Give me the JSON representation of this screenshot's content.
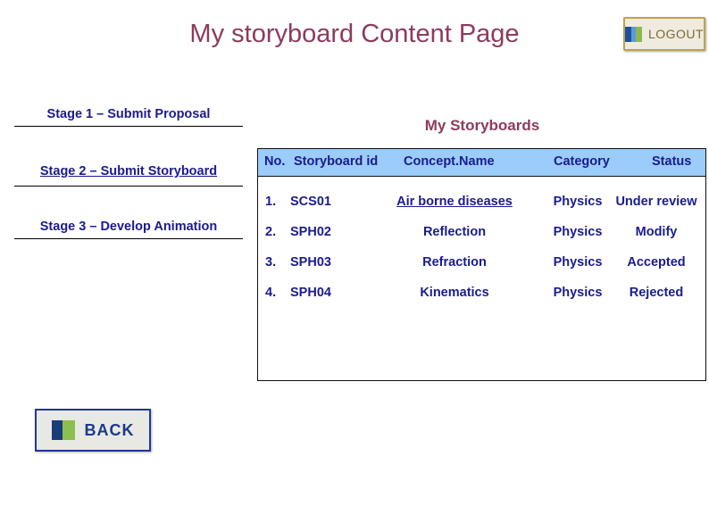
{
  "page": {
    "title": "My storyboard Content Page",
    "background": "#ffffff",
    "title_color": "#8C3B5E"
  },
  "logout_button": {
    "label": "LOGOUT",
    "icon": "three-bar-logo-icon",
    "bg_color": "#EFEBDE",
    "border_color": "#BDA34F",
    "text_color": "#7C6A34"
  },
  "sidebar": {
    "items": [
      {
        "label": "Stage 1 – Submit Proposal",
        "underlined": false
      },
      {
        "label": "Stage 2 – Submit Storyboard",
        "underlined": true
      },
      {
        "label": "Stage 3 – Develop Animation",
        "underlined": false
      }
    ],
    "link_color": "#1B1B8F"
  },
  "storyboards": {
    "heading": "My Storyboards",
    "heading_color": "#8C3B5E",
    "header_bg": "#9BCCFA",
    "text_color": "#1B1B8F",
    "columns": {
      "no": "No.",
      "id": "Storyboard id",
      "concept": "Concept.Name",
      "category": "Category",
      "status": "Status"
    },
    "rows": [
      {
        "no": "1.",
        "id": "SCS01",
        "concept": "Air borne diseases",
        "concept_is_link": true,
        "category": "Physics",
        "status": "Under review"
      },
      {
        "no": "2.",
        "id": "SPH02",
        "concept": "Reflection",
        "concept_is_link": false,
        "category": "Physics",
        "status": "Modify"
      },
      {
        "no": "3.",
        "id": "SPH03",
        "concept": "Refraction",
        "concept_is_link": false,
        "category": "Physics",
        "status": "Accepted"
      },
      {
        "no": "4.",
        "id": "SPH04",
        "concept": "Kinematics",
        "concept_is_link": false,
        "category": "Physics",
        "status": "Rejected"
      }
    ]
  },
  "back_button": {
    "label": "BACK",
    "icon": "two-bar-logo-icon",
    "bg_color": "#E9E9E4",
    "border_color": "#22379B",
    "text_color": "#1B3A8C"
  }
}
